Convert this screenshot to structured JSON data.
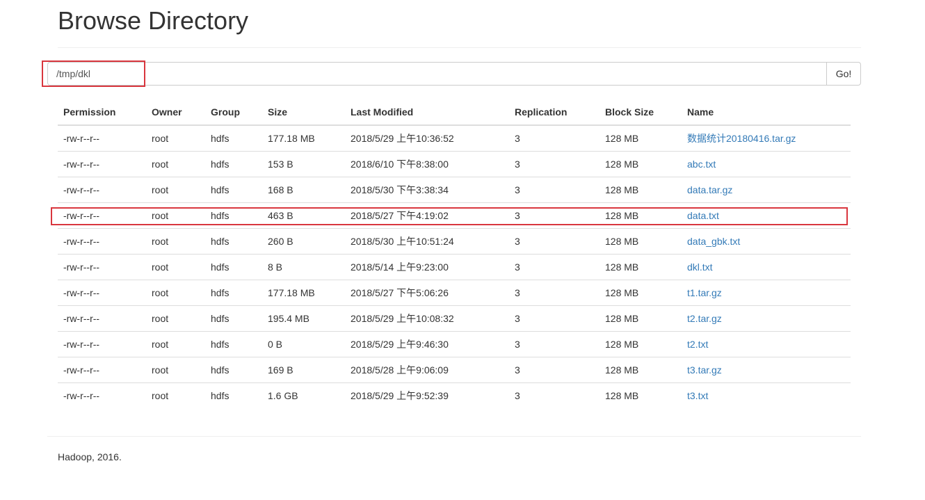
{
  "page": {
    "title": "Browse Directory"
  },
  "path_form": {
    "value": "/tmp/dkl",
    "go_label": "Go!"
  },
  "table": {
    "headers": {
      "permission": "Permission",
      "owner": "Owner",
      "group": "Group",
      "size": "Size",
      "last_modified": "Last Modified",
      "replication": "Replication",
      "block_size": "Block Size",
      "name": "Name"
    },
    "rows": [
      {
        "permission": "-rw-r--r--",
        "owner": "root",
        "group": "hdfs",
        "size": "177.18 MB",
        "last_modified": "2018/5/29 上午10:36:52",
        "replication": "3",
        "block_size": "128 MB",
        "name": "数据统计20180416.tar.gz"
      },
      {
        "permission": "-rw-r--r--",
        "owner": "root",
        "group": "hdfs",
        "size": "153 B",
        "last_modified": "2018/6/10 下午8:38:00",
        "replication": "3",
        "block_size": "128 MB",
        "name": "abc.txt"
      },
      {
        "permission": "-rw-r--r--",
        "owner": "root",
        "group": "hdfs",
        "size": "168 B",
        "last_modified": "2018/5/30 下午3:38:34",
        "replication": "3",
        "block_size": "128 MB",
        "name": "data.tar.gz"
      },
      {
        "permission": "-rw-r--r--",
        "owner": "root",
        "group": "hdfs",
        "size": "463 B",
        "last_modified": "2018/5/27 下午4:19:02",
        "replication": "3",
        "block_size": "128 MB",
        "name": "data.txt"
      },
      {
        "permission": "-rw-r--r--",
        "owner": "root",
        "group": "hdfs",
        "size": "260 B",
        "last_modified": "2018/5/30 上午10:51:24",
        "replication": "3",
        "block_size": "128 MB",
        "name": "data_gbk.txt"
      },
      {
        "permission": "-rw-r--r--",
        "owner": "root",
        "group": "hdfs",
        "size": "8 B",
        "last_modified": "2018/5/14 上午9:23:00",
        "replication": "3",
        "block_size": "128 MB",
        "name": "dkl.txt"
      },
      {
        "permission": "-rw-r--r--",
        "owner": "root",
        "group": "hdfs",
        "size": "177.18 MB",
        "last_modified": "2018/5/27 下午5:06:26",
        "replication": "3",
        "block_size": "128 MB",
        "name": "t1.tar.gz"
      },
      {
        "permission": "-rw-r--r--",
        "owner": "root",
        "group": "hdfs",
        "size": "195.4 MB",
        "last_modified": "2018/5/29 上午10:08:32",
        "replication": "3",
        "block_size": "128 MB",
        "name": "t2.tar.gz"
      },
      {
        "permission": "-rw-r--r--",
        "owner": "root",
        "group": "hdfs",
        "size": "0 B",
        "last_modified": "2018/5/29 上午9:46:30",
        "replication": "3",
        "block_size": "128 MB",
        "name": "t2.txt"
      },
      {
        "permission": "-rw-r--r--",
        "owner": "root",
        "group": "hdfs",
        "size": "169 B",
        "last_modified": "2018/5/28 上午9:06:09",
        "replication": "3",
        "block_size": "128 MB",
        "name": "t3.tar.gz"
      },
      {
        "permission": "-rw-r--r--",
        "owner": "root",
        "group": "hdfs",
        "size": "1.6 GB",
        "last_modified": "2018/5/29 上午9:52:39",
        "replication": "3",
        "block_size": "128 MB",
        "name": "t3.txt"
      }
    ]
  },
  "footer": {
    "text": "Hadoop, 2016."
  },
  "colors": {
    "link": "#337ab7",
    "highlight": "#d9363e",
    "text": "#333333"
  }
}
